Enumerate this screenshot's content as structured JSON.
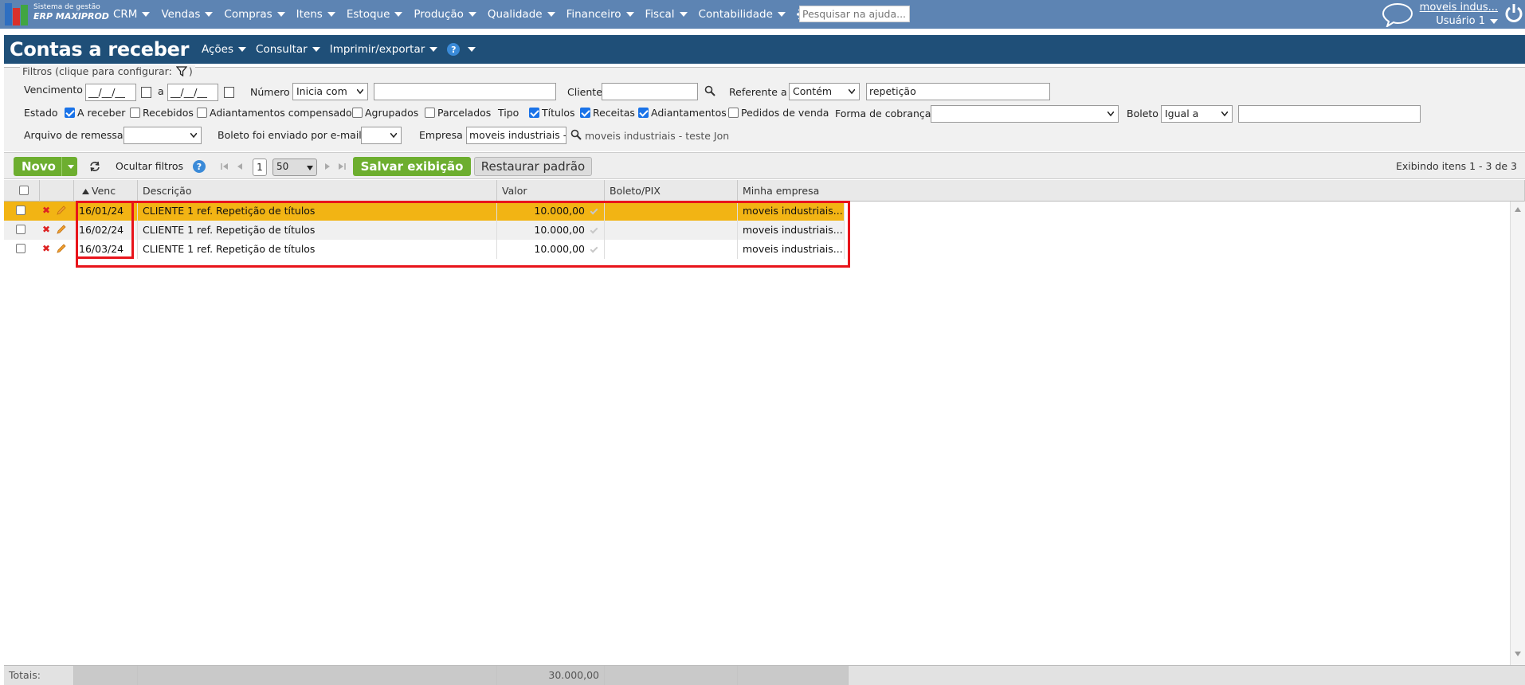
{
  "brand": {
    "line1": "Sistema de gestão",
    "line2": "ERP MAXIPROD"
  },
  "nav": {
    "items": [
      "CRM",
      "Vendas",
      "Compras",
      "Itens",
      "Estoque",
      "Produção",
      "Qualidade",
      "Financeiro",
      "Fiscal",
      "Contabilidade"
    ],
    "help_placeholder": "Pesquisar na ajuda..."
  },
  "user": {
    "company": "moveis indus...",
    "name": "Usuário 1"
  },
  "page": {
    "title": "Contas a receber",
    "menu": [
      "Ações",
      "Consultar",
      "Imprimir/exportar"
    ],
    "help_glyph": "?"
  },
  "filters": {
    "legend": "Filtros (clique para configurar:",
    "legend_close": ")",
    "vencimento_label": "Vencimento",
    "date_from": "__/__/__",
    "date_sep": "a",
    "date_to": "__/__/__",
    "numero_label": "Número",
    "numero_mode": "Inicia com",
    "numero_value": "",
    "cliente_label": "Cliente",
    "cliente_value": "",
    "referente_label": "Referente a",
    "referente_mode": "Contém",
    "referente_value": "repetição",
    "estado_label": "Estado",
    "estado_options": [
      {
        "label": "A receber",
        "checked": true
      },
      {
        "label": "Recebidos",
        "checked": false
      },
      {
        "label": "Adiantamentos compensados",
        "checked": false
      },
      {
        "label": "Agrupados",
        "checked": false
      },
      {
        "label": "Parcelados",
        "checked": false
      }
    ],
    "tipo_label": "Tipo",
    "tipo_options": [
      {
        "label": "Títulos",
        "checked": true
      },
      {
        "label": "Receitas",
        "checked": true
      },
      {
        "label": "Adiantamentos",
        "checked": true
      },
      {
        "label": "Pedidos de venda",
        "checked": false
      }
    ],
    "forma_label": "Forma de cobrança",
    "forma_value": "",
    "boleto_label": "Boleto",
    "boleto_mode": "Igual a",
    "boleto_value": "",
    "remessa_label": "Arquivo de remessa",
    "remessa_value": "",
    "email_label": "Boleto foi enviado por e-mail",
    "email_value": "",
    "empresa_label": "Empresa",
    "empresa_value": "moveis industriais -",
    "empresa_desc": "moveis industriais - teste Jon"
  },
  "toolbar": {
    "novo": "Novo",
    "ocultar": "Ocultar filtros",
    "page": "1",
    "page_size": "50",
    "salvar": "Salvar exibição",
    "restaurar": "Restaurar padrão",
    "showing": "Exibindo itens 1 - 3 de 3"
  },
  "columns": [
    "Venc",
    "Descrição",
    "Valor",
    "Boleto/PIX",
    "Minha empresa"
  ],
  "rows": [
    {
      "venc": "16/01/24",
      "descricao": "CLIENTE 1 ref. Repetição de títulos",
      "valor": "10.000,00",
      "boleto": "",
      "empresa": "moveis industriais..."
    },
    {
      "venc": "16/02/24",
      "descricao": "CLIENTE 1 ref. Repetição de títulos",
      "valor": "10.000,00",
      "boleto": "",
      "empresa": "moveis industriais..."
    },
    {
      "venc": "16/03/24",
      "descricao": "CLIENTE 1 ref. Repetição de títulos",
      "valor": "10.000,00",
      "boleto": "",
      "empresa": "moveis industriais..."
    }
  ],
  "footer": {
    "label": "Totais:",
    "total": "30.000,00"
  },
  "colors": {
    "nav": "#5d84b3",
    "title": "#1f4f78",
    "green": "#6dae2f",
    "selected_row": "#f2b414",
    "highlight": "#e8141b"
  }
}
